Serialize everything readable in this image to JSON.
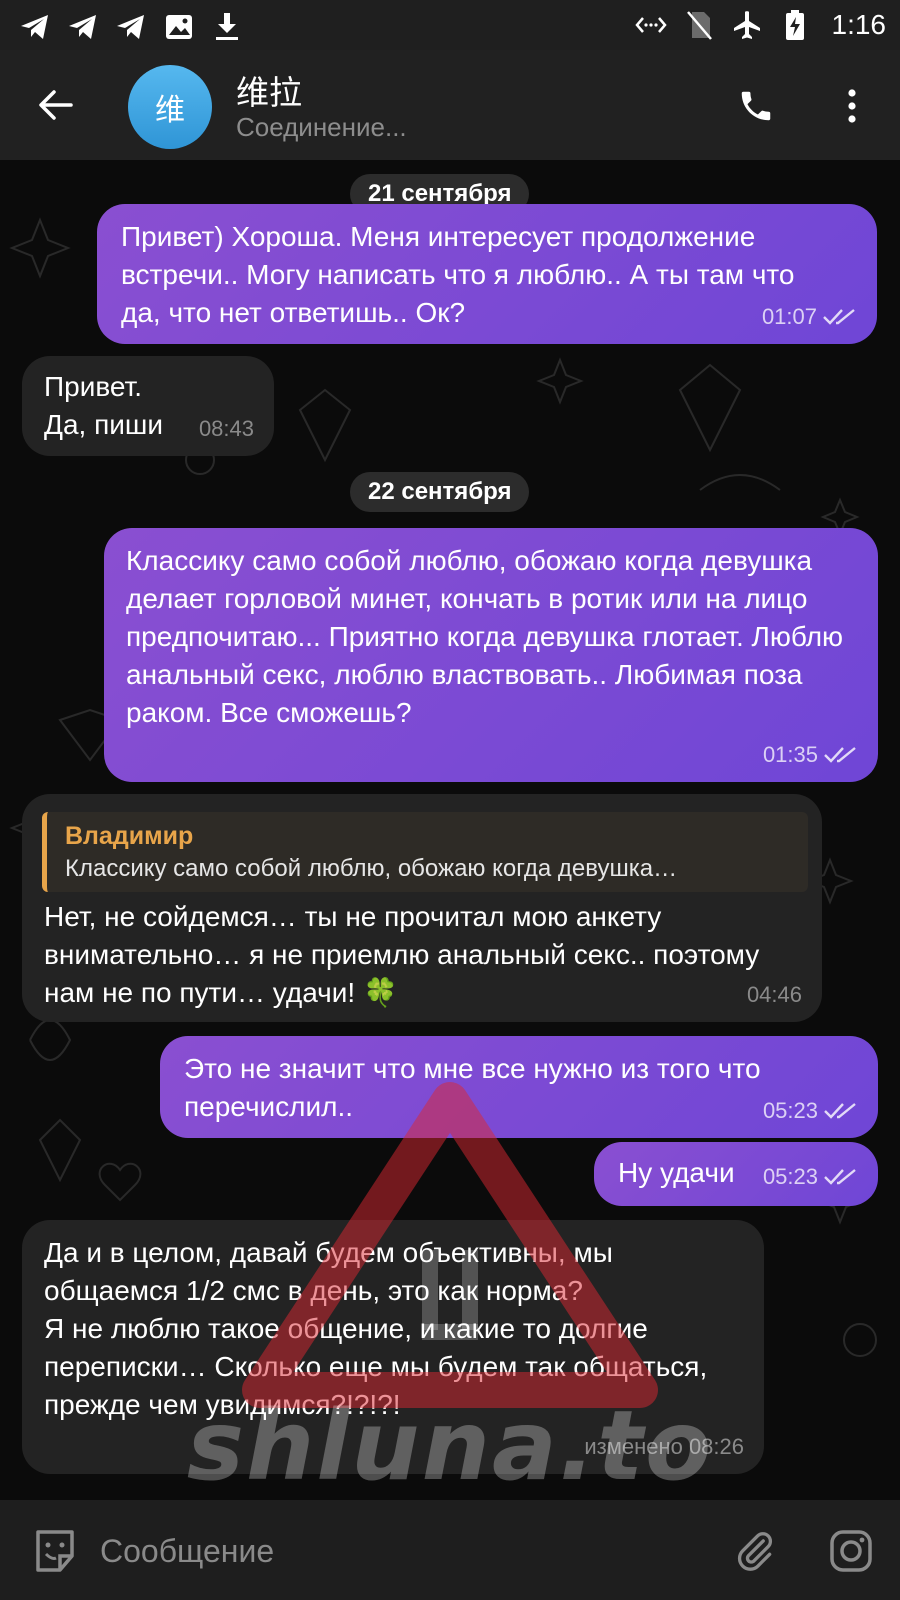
{
  "status_bar": {
    "left_icons": [
      "telegram-icon",
      "telegram-icon",
      "telegram-icon",
      "image-icon",
      "download-icon"
    ],
    "right_icons": [
      "data-saver-icon",
      "no-sim-icon",
      "airplane-mode-icon",
      "battery-charging-icon"
    ],
    "time": "1:16"
  },
  "header": {
    "avatar_letter": "维",
    "title": "维拉",
    "status": "Соединение...",
    "avatar_color": "#3ea6e3"
  },
  "messages": {
    "date1": "21 сентября",
    "m1": {
      "text": "Привет) Хороша. Меня интересует продолжение встречи.. Могу написать что я люблю.. А ты там что да, что нет ответишь.. Ок?",
      "time": "01:07"
    },
    "m2": {
      "text": "Привет.\nДа, пиши",
      "time": "08:43"
    },
    "date2": "22 сентября",
    "m3": {
      "text": "Классику само собой люблю, обожаю когда девушка делает горловой минет, кончать в ротик или на лицо предпочитаю... Приятно когда девушка глотает. Люблю анальный секс, люблю властвовать.. Любимая поза раком. Все сможешь?",
      "time": "01:35"
    },
    "m4": {
      "reply_name": "Владимир",
      "reply_text": "Классику само собой люблю, обожаю когда девушка…",
      "text": "Нет, не сойдемся… ты не прочитал мою анкету внимательно… я не приемлю анальный секс.. поэтому нам не по пути… удачи! 🍀",
      "time": "04:46"
    },
    "m5": {
      "text": "Это не значит что мне все нужно из того что перечислил..",
      "time": "05:23"
    },
    "m6": {
      "text": "Ну удачи",
      "time": "05:23"
    },
    "m7": {
      "text": "Да и в целом, давай будем объективны, мы общаемся 1/2 смс в день, это как норма?\nЯ не люблю такое общение, и какие то долгие переписки… Сколько еще мы будем так общаться, прежде чем увидимся?!?!?!",
      "time": "изменено 08:26"
    }
  },
  "watermark": {
    "text": "shluna.to"
  },
  "input": {
    "placeholder": "Сообщение"
  },
  "colors": {
    "outgoing_bubble": "#7b4bd6",
    "incoming_bubble": "#232323",
    "reply_accent": "#e8a54a"
  }
}
